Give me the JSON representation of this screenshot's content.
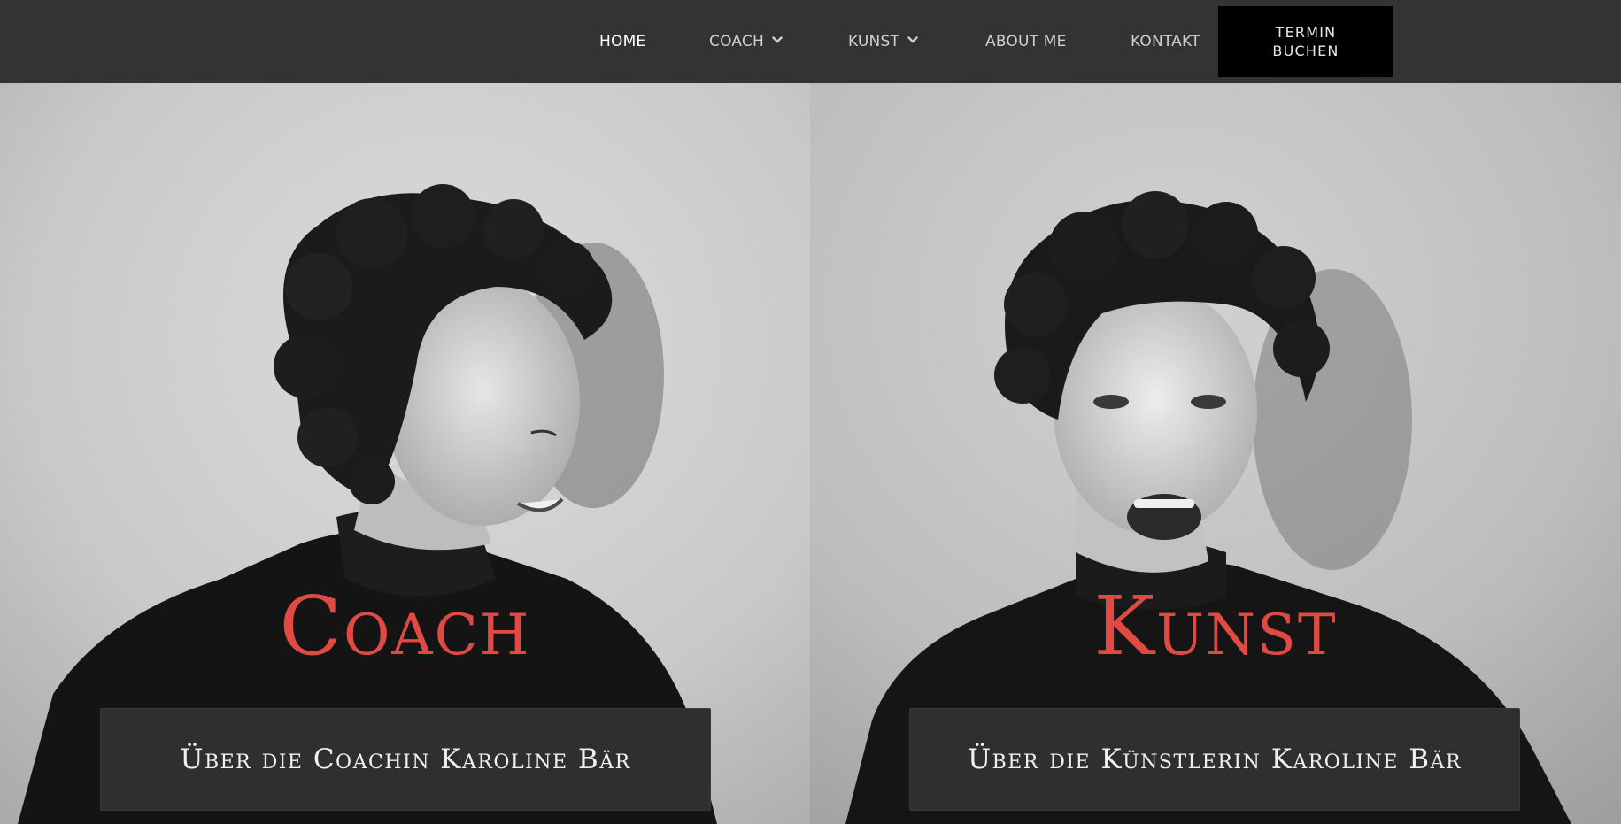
{
  "nav": {
    "items": [
      {
        "label": "HOME",
        "active": true,
        "has_dropdown": false
      },
      {
        "label": "COACH",
        "active": false,
        "has_dropdown": true
      },
      {
        "label": "KUNST",
        "active": false,
        "has_dropdown": true
      },
      {
        "label": "ABOUT ME",
        "active": false,
        "has_dropdown": false
      },
      {
        "label": "KONTAKT",
        "active": false,
        "has_dropdown": false
      }
    ],
    "cta_line1": "TERMIN",
    "cta_line2": "BUCHEN"
  },
  "panels": {
    "left": {
      "title": "Coach",
      "button_label": "Über die Coachin Karoline Bär",
      "image": "black-and-white portrait, woman with curly hair looking to the side, smiling"
    },
    "right": {
      "title": "Kunst",
      "button_label": "Über die Künstlerin Karoline Bär",
      "image": "black-and-white portrait, woman with curly hair laughing toward camera"
    }
  },
  "colors": {
    "header_bg": "#333333",
    "cta_bg": "#000000",
    "title_accent": "#e04a42",
    "button_bg": "#2f2f2f"
  },
  "icons": {
    "dropdown": "chevron-down-icon"
  }
}
